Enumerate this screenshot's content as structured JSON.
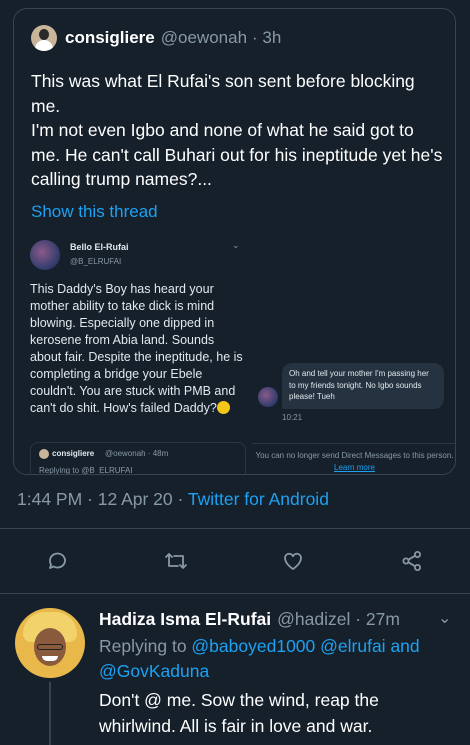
{
  "quoted_tweet": {
    "name": "consigliere",
    "handle": "@oewonah",
    "time": "· 3h",
    "body": "This was what El Rufai's son sent before blocking me.\nI'm not even Igbo and none of what he said got to me. He can't call Buhari out for his ineptitude yet he's calling trump names?...",
    "show_thread": "Show this thread",
    "embedded_screenshot": {
      "name": "Bello El-Rufai",
      "handle": "@B_ELRUFAI",
      "text": "This Daddy's Boy has heard your mother ability to take dick is mind blowing. Especially one dipped in kerosene from Abia land. Sounds about fair. Despite the ineptitude, he is completing a bridge your Ebele couldn't. You are stuck with PMB and can't do shit. How's failed Daddy?",
      "quote_name": "consigliere",
      "quote_handle": "@oewonah",
      "quote_time": "48m",
      "quote_reply": "Replying to @B_ELRUFAI",
      "dm_message": "Oh and tell your mother I'm passing her to my friends tonight. No Igbo sounds please! Tueh",
      "dm_time": "10:21",
      "dm_notice": "You can no longer send Direct Messages to this person.",
      "dm_learn": "Learn more"
    }
  },
  "meta": {
    "time": "1:44 PM · 12 Apr 20 · ",
    "source": "Twitter for Android"
  },
  "actions": {
    "reply_icon": "speech-bubble-icon",
    "retweet_icon": "retweet-icon",
    "like_icon": "heart-icon",
    "share_icon": "share-icon"
  },
  "reply_tweet": {
    "name": "Hadiza Isma El-Rufai",
    "handle": "@hadizel · 27m",
    "replying_label": "Replying to ",
    "mention1": "@baboyed1000",
    "mention2": "@elrufai",
    "and_word": " and ",
    "mention3": "@GovKaduna",
    "text": "Don't @ me. Sow the wind, reap the whirlwind. All is fair in love and war."
  },
  "colors": {
    "background": "#15202b",
    "accent": "#1da1f2",
    "secondary_text": "#8899a6",
    "border": "#38444d"
  }
}
